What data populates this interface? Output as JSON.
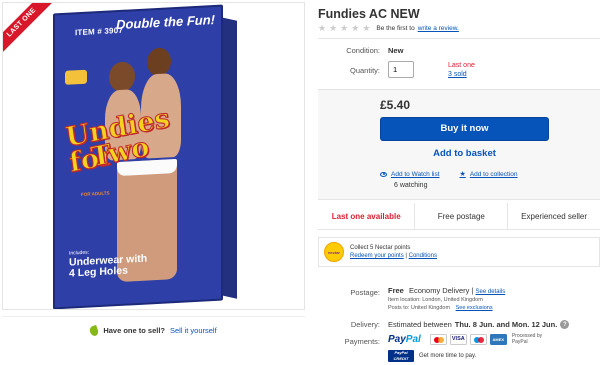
{
  "image_panel": {
    "ribbon": "LAST ONE",
    "box": {
      "item_no": "ITEM # 3907",
      "double_fun": "Double the Fun!",
      "title_line1": "Undies for",
      "title_line2": "Two",
      "for_adults": "FOR ADULTS",
      "includes": "Includes:",
      "includes_big": "Underwear with 4 Leg Holes"
    }
  },
  "sell_bar": {
    "question": "Have one to sell?",
    "link": "Sell it yourself"
  },
  "listing": {
    "title": "Fundies AC NEW",
    "rating_stars": 0,
    "review_prefix": "Be the first to",
    "review_link": "write a review."
  },
  "condition": {
    "label": "Condition:",
    "value": "New"
  },
  "quantity": {
    "label": "Quantity:",
    "value": "1",
    "last_one": "Last one",
    "sold": "3 sold"
  },
  "buy_box": {
    "price": "£5.40",
    "buy_now": "Buy it now",
    "add_basket": "Add to basket",
    "watch_list": "Add to Watch list",
    "collection": "Add to collection",
    "watching": "6 watching"
  },
  "badges": {
    "last_one": "Last one available",
    "free_postage": "Free postage",
    "experienced": "Experienced seller"
  },
  "nectar": {
    "logo": "nectar",
    "collect": "Collect 5 Nectar points",
    "redeem": "Redeem your points",
    "separator": " | ",
    "conditions": "Conditions"
  },
  "postage": {
    "label": "Postage:",
    "free": "Free",
    "service": "Economy Delivery",
    "separator": " | ",
    "see_details": "See details",
    "item_location": "Item location:  London, United Kingdom",
    "posts_to": "Posts to:  United Kingdom",
    "see_exclusions": "See exclusions"
  },
  "delivery": {
    "label": "Delivery:",
    "prefix": "Estimated between",
    "range": "Thu. 8 Jun. and Mon. 12 Jun.",
    "help": "?"
  },
  "payments": {
    "label": "Payments:",
    "paypal_a": "Pay",
    "paypal_b": "Pal",
    "cards": [
      "Mastercard",
      "VISA",
      "Maestro",
      "AMEX"
    ],
    "processed": "Processed by PayPal",
    "credit_logo": "PayPal CREDIT",
    "credit_text": "Get more time to pay."
  },
  "colors": {
    "link": "#0654ba",
    "red": "#dd1e31",
    "buy_button": "#0654ba",
    "box_blue": "#2f3fa8",
    "title_yellow": "#f4d320"
  }
}
